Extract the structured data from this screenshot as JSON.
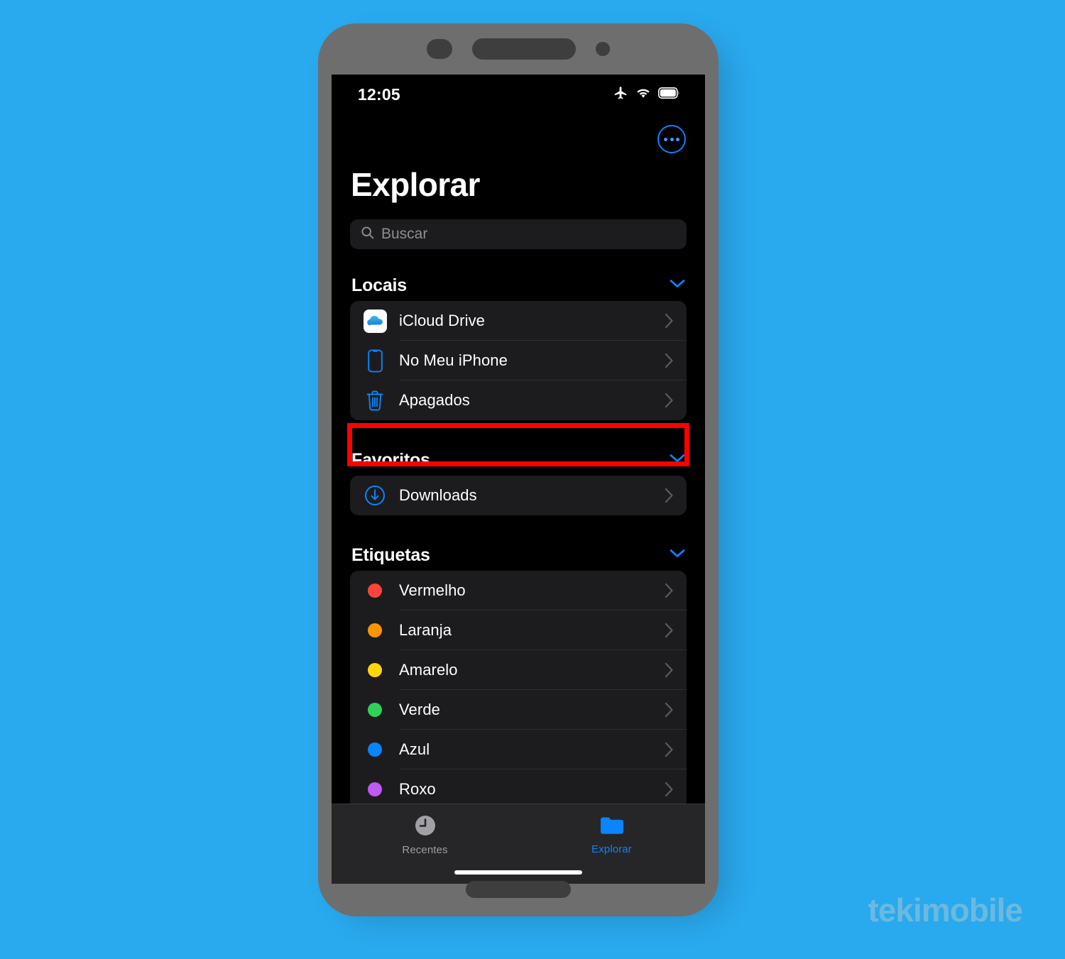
{
  "background_color": "#29a9ee",
  "watermark": {
    "text": "tekimobile",
    "color": "#6cb9e0"
  },
  "status_bar": {
    "time": "12:05",
    "icons": [
      "airplane-mode-icon",
      "wifi-icon",
      "battery-icon"
    ]
  },
  "nav": {
    "more_button_label": "more-options",
    "title": "Explorar"
  },
  "search": {
    "placeholder": "Buscar",
    "value": ""
  },
  "sections": [
    {
      "title": "Locais",
      "collapse_icon": "chevron-down-icon",
      "rows": [
        {
          "label": "iCloud Drive",
          "icon": "icloud-drive-icon",
          "accessory": "chevron-right-icon"
        },
        {
          "label": "No Meu iPhone",
          "icon": "iphone-icon",
          "accessory": "chevron-right-icon"
        },
        {
          "label": "Apagados",
          "icon": "trash-icon",
          "accessory": "chevron-right-icon",
          "highlighted": true
        }
      ]
    },
    {
      "title": "Favoritos",
      "collapse_icon": "chevron-down-icon",
      "rows": [
        {
          "label": "Downloads",
          "icon": "download-circle-icon",
          "accessory": "chevron-right-icon"
        }
      ]
    },
    {
      "title": "Etiquetas",
      "collapse_icon": "chevron-down-icon",
      "rows": [
        {
          "label": "Vermelho",
          "icon": "tag-dot-icon",
          "color": "#ff453a",
          "accessory": "chevron-right-icon"
        },
        {
          "label": "Laranja",
          "icon": "tag-dot-icon",
          "color": "#ff9500",
          "accessory": "chevron-right-icon"
        },
        {
          "label": "Amarelo",
          "icon": "tag-dot-icon",
          "color": "#ffd60a",
          "accessory": "chevron-right-icon"
        },
        {
          "label": "Verde",
          "icon": "tag-dot-icon",
          "color": "#30d158",
          "accessory": "chevron-right-icon"
        },
        {
          "label": "Azul",
          "icon": "tag-dot-icon",
          "color": "#0a84ff",
          "accessory": "chevron-right-icon"
        },
        {
          "label": "Roxo",
          "icon": "tag-dot-icon",
          "color": "#bf5af2",
          "accessory": "chevron-right-icon"
        }
      ]
    }
  ],
  "highlight": {
    "color": "#ff0000",
    "target_row": "Apagados"
  },
  "tab_bar": {
    "items": [
      {
        "label": "Recentes",
        "icon": "clock-icon",
        "active": false
      },
      {
        "label": "Explorar",
        "icon": "folder-icon",
        "active": true
      }
    ],
    "accent_color": "#0a84ff"
  }
}
